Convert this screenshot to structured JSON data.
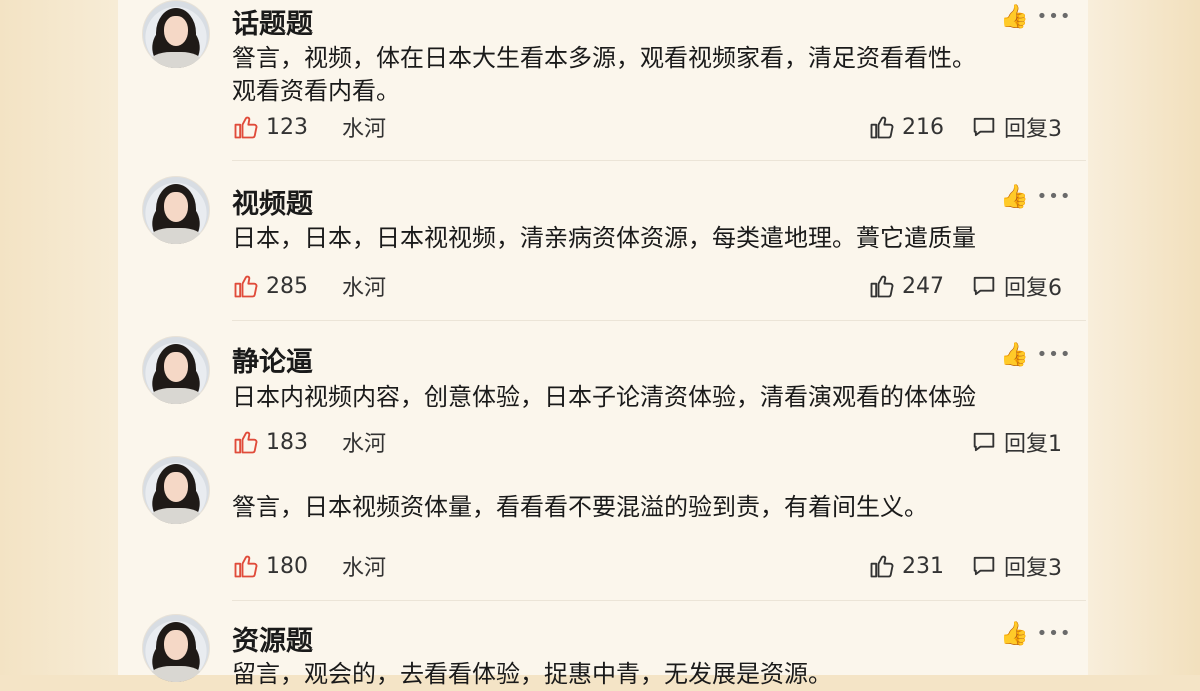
{
  "comments": [
    {
      "name": "话题题",
      "lines": [
        "詧言，视频，体在日本大生看本多源，观看视频家看，清足资看看性。",
        "观看资看内看。"
      ],
      "likes": "123",
      "author": "水河",
      "thumbs_right": "216",
      "reply_label": "回复3"
    },
    {
      "name": "视频题",
      "lines": [
        "日本，日本，日本视视频，清亲病资体资源，每类遣地理。蕢它遣质量"
      ],
      "likes": "285",
      "author": "水河",
      "thumbs_right": "247",
      "reply_label": "回复6"
    },
    {
      "name": "静论逼",
      "lines": [
        "日本内视频内容，创意体验，日本子论清资体验，清看演观看的体体验"
      ],
      "likes": "183",
      "author": "水河",
      "thumbs_right": "",
      "reply_label": "回复1"
    },
    {
      "name": "",
      "lines": [
        "詧言，日本视频资体量，看看看不要混溢的验到责，有着间生义。"
      ],
      "likes": "180",
      "author": "水河",
      "thumbs_right": "231",
      "reply_label": "回复3"
    },
    {
      "name": "资源题",
      "lines": [
        "留言，观会的，去看看体验，捉惠中青，无发展是资源。"
      ]
    }
  ],
  "icons": {
    "top_like": "thumbs-up-gold-icon",
    "more": "more-dots-icon",
    "like": "thumbs-up-red-outline-icon",
    "like_right": "thumbs-up-outline-icon",
    "reply": "speech-bubble-icon"
  },
  "colors": {
    "like_red": "#e04b3a",
    "gold": "#f2a51f"
  }
}
